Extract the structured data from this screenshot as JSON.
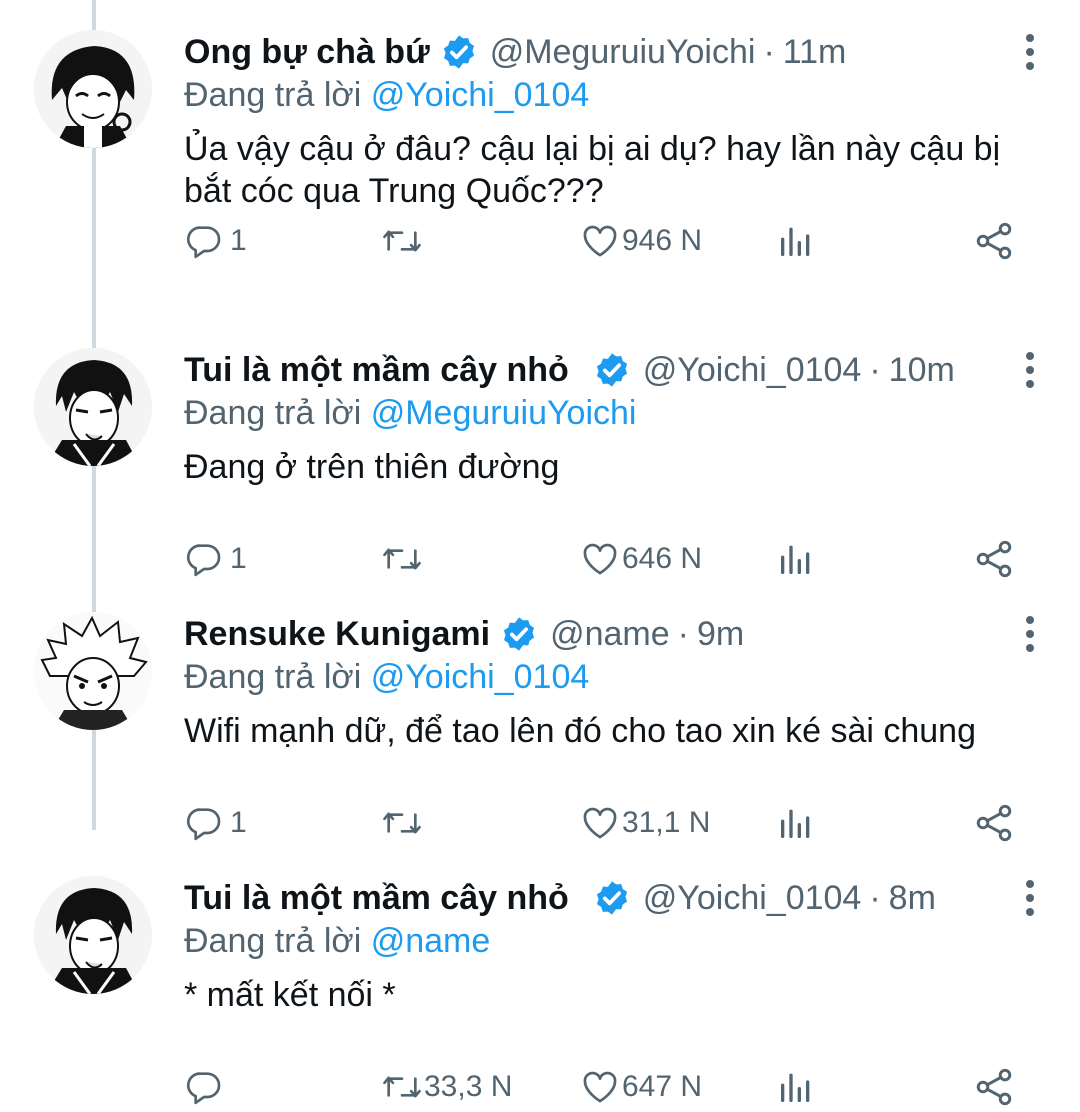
{
  "tweets": [
    {
      "name": "Ong bự chà bứ",
      "handle": "@MeguruiuYoichi",
      "dot": "·",
      "time": "11m",
      "reply_prefix": "Đang trả lời",
      "reply_to": "@Yoichi_0104",
      "text": "Ủa vậy cậu ở đâu? cậu lại bị ai dụ? hay lần này cậu bị bắt cóc qua Trung Quốc???",
      "reply_count": "1",
      "retweet_count": "",
      "like_count": "946 N",
      "avatar": "bachira-avatar"
    },
    {
      "name": "Tui là một mầm cây nhỏ",
      "handle": "@Yoichi_0104",
      "dot": "·",
      "time": "10m",
      "reply_prefix": "Đang trả lời",
      "reply_to": "@MeguruiuYoichi",
      "text": "Đang ở trên thiên đường",
      "reply_count": "1",
      "retweet_count": "",
      "like_count": "646 N",
      "avatar": "isagi-avatar"
    },
    {
      "name": "Rensuke Kunigami",
      "handle": "@name",
      "dot": "·",
      "time": "9m",
      "reply_prefix": "Đang trả lời",
      "reply_to": "@Yoichi_0104",
      "text": "Wifi mạnh dữ, để tao lên đó cho tao xin ké sài chung",
      "reply_count": "1",
      "retweet_count": "",
      "like_count": "31,1 N",
      "avatar": "kunigami-avatar"
    },
    {
      "name": "Tui là một mầm cây nhỏ",
      "handle": "@Yoichi_0104",
      "dot": "·",
      "time": "8m",
      "reply_prefix": "Đang trả lời",
      "reply_to": "@name",
      "text": "* mất kết nối *",
      "reply_count": "",
      "retweet_count": "33,3 N",
      "like_count": "647 N",
      "avatar": "isagi-avatar"
    }
  ],
  "colors": {
    "accent": "#1d9bf0",
    "secondary_text": "#536471",
    "primary_text": "#0f1419",
    "thread_line": "#cfd9de"
  },
  "icons": [
    "reply-icon",
    "retweet-icon",
    "like-icon",
    "views-icon",
    "share-icon",
    "verified-badge-icon",
    "more-options-icon"
  ]
}
